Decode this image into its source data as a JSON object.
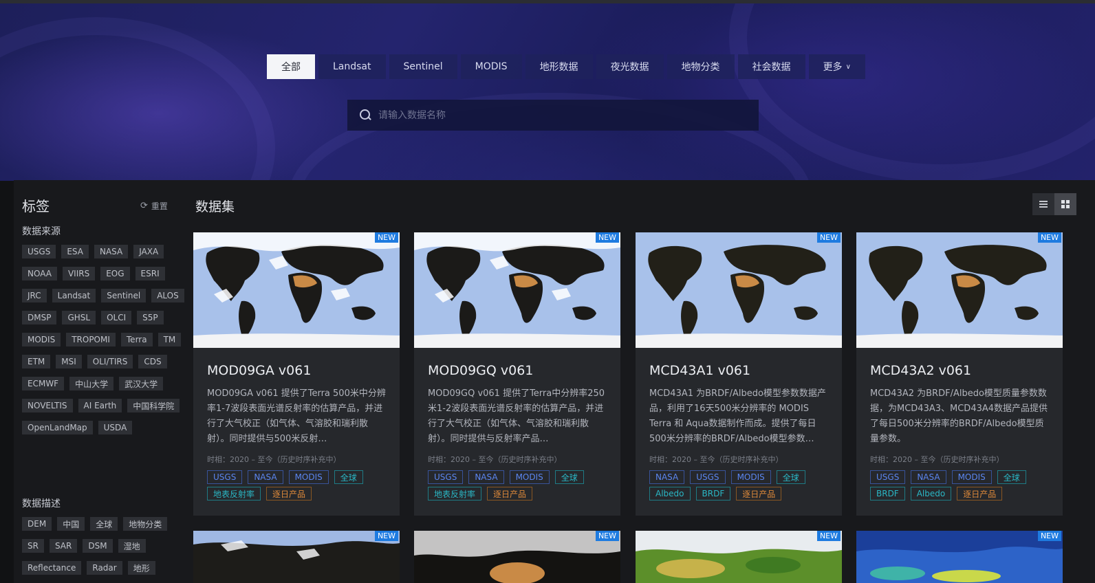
{
  "categories": [
    {
      "label": "全部",
      "active": true
    },
    {
      "label": "Landsat",
      "active": false
    },
    {
      "label": "Sentinel",
      "active": false
    },
    {
      "label": "MODIS",
      "active": false
    },
    {
      "label": "地形数据",
      "active": false
    },
    {
      "label": "夜光数据",
      "active": false
    },
    {
      "label": "地物分类",
      "active": false
    },
    {
      "label": "社会数据",
      "active": false
    },
    {
      "label": "更多",
      "active": false,
      "dropdown": true
    }
  ],
  "search": {
    "placeholder": "请输入数据名称",
    "value": ""
  },
  "sidebar": {
    "title": "标签",
    "reset_label": "重置",
    "sections": [
      {
        "title": "数据来源",
        "tags": [
          "USGS",
          "ESA",
          "NASA",
          "JAXA",
          "NOAA",
          "VIIRS",
          "EOG",
          "ESRI",
          "JRC",
          "Landsat",
          "Sentinel",
          "ALOS",
          "DMSP",
          "GHSL",
          "OLCI",
          "S5P",
          "MODIS",
          "TROPOMI",
          "Terra",
          "TM",
          "ETM",
          "MSI",
          "OLI/TIRS",
          "CDS",
          "ECMWF",
          "中山大学",
          "武汉大学",
          "NOVELTIS",
          "AI Earth",
          "中国科学院",
          "OpenLandMap",
          "USDA"
        ]
      },
      {
        "title": "数据描述",
        "tags": [
          "DEM",
          "中国",
          "全球",
          "地物分类",
          "SR",
          "SAR",
          "DSM",
          "湿地",
          "Reflectance",
          "Radar",
          "地形"
        ]
      }
    ]
  },
  "main": {
    "title": "数据集",
    "view_modes": [
      "list",
      "grid"
    ],
    "active_view": "grid",
    "badge_label": "NEW",
    "cards": [
      {
        "name": "MOD09GA v061",
        "desc": "MOD09GA v061 提供了Terra 500米中分辨率1-7波段表面光谱反射率的估算产品，并进行了大气校正（如气体、气溶胶和瑞利散射）。同时提供与500米反射…",
        "time": "时相：2020 – 至今（历史时序补充中）",
        "tags": [
          {
            "label": "USGS",
            "color": "blue"
          },
          {
            "label": "NASA",
            "color": "blue"
          },
          {
            "label": "MODIS",
            "color": "blue"
          },
          {
            "label": "全球",
            "color": "cyan"
          },
          {
            "label": "地表反射率",
            "color": "cyan"
          },
          {
            "label": "逐日产品",
            "color": "orange"
          }
        ]
      },
      {
        "name": "MOD09GQ v061",
        "desc": "MOD09GQ v061 提供了Terra中分辨率250米1-2波段表面光谱反射率的估算产品，并进行了大气校正（如气体、气溶胶和瑞利散射）。同时提供与反射率产品…",
        "time": "时相：2020 – 至今（历史时序补充中）",
        "tags": [
          {
            "label": "USGS",
            "color": "blue"
          },
          {
            "label": "NASA",
            "color": "blue"
          },
          {
            "label": "MODIS",
            "color": "blue"
          },
          {
            "label": "全球",
            "color": "cyan"
          },
          {
            "label": "地表反射率",
            "color": "cyan"
          },
          {
            "label": "逐日产品",
            "color": "orange"
          }
        ]
      },
      {
        "name": "MCD43A1 v061",
        "desc": "MCD43A1 为BRDF/Albedo模型参数数据产品，利用了16天500米分辨率的 MODIS Terra 和 Aqua数据制作而成。提供了每日500米分辨率的BRDF/Albedo模型参数…",
        "time": "时相：2020 – 至今（历史时序补充中）",
        "tags": [
          {
            "label": "NASA",
            "color": "blue"
          },
          {
            "label": "USGS",
            "color": "blue"
          },
          {
            "label": "MODIS",
            "color": "blue"
          },
          {
            "label": "全球",
            "color": "cyan"
          },
          {
            "label": "Albedo",
            "color": "cyan"
          },
          {
            "label": "BRDF",
            "color": "cyan"
          },
          {
            "label": "逐日产品",
            "color": "orange"
          }
        ]
      },
      {
        "name": "MCD43A2 v061",
        "desc": "MCD43A2 为BRDF/Albedo模型质量参数数据，为MCD43A3、MCD43A4数据产品提供了每日500米分辨率的BRDF/Albedo模型质量参数。",
        "time": "时相：2020 – 至今（历史时序补充中）",
        "tags": [
          {
            "label": "USGS",
            "color": "blue"
          },
          {
            "label": "NASA",
            "color": "blue"
          },
          {
            "label": "MODIS",
            "color": "blue"
          },
          {
            "label": "全球",
            "color": "cyan"
          },
          {
            "label": "BRDF",
            "color": "cyan"
          },
          {
            "label": "Albedo",
            "color": "cyan"
          },
          {
            "label": "逐日产品",
            "color": "orange"
          }
        ]
      }
    ]
  },
  "colors": {
    "accent_badge": "#1e7be0",
    "tag_blue": "#5b86f0",
    "tag_cyan": "#2ab7c5",
    "tag_orange": "#e08a3a"
  },
  "icons": [
    "search-icon",
    "refresh-icon",
    "chevron-down-icon",
    "list-view-icon",
    "grid-view-icon"
  ]
}
